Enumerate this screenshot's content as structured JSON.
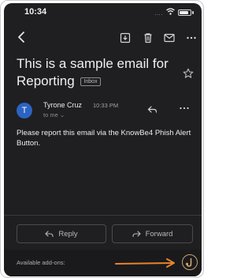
{
  "status_bar": {
    "time": "10:34",
    "signal_dots": "....",
    "wifi_icon": "wifi-icon",
    "battery_icon": "battery-icon"
  },
  "toolbar": {
    "back_icon": "chevron-left-icon",
    "archive_icon": "archive-icon",
    "delete_icon": "trash-icon",
    "mark_unread_icon": "mail-icon",
    "more_icon": "more-horizontal-icon"
  },
  "email": {
    "subject": "This is a sample email for Reporting",
    "label": "Inbox",
    "star_icon": "star-icon",
    "sender": {
      "initial": "T",
      "name": "Tyrone Cruz",
      "time": "10:33 PM",
      "recipient": "to me",
      "avatar_color": "#2b63c2"
    },
    "body": "Please report this email via the KnowBe4 Phish Alert Button."
  },
  "actions": {
    "reply_label": "Reply",
    "forward_label": "Forward"
  },
  "addons": {
    "label": "Available add-ons:",
    "addon_icon": "phish-hook-icon",
    "annotation_color": "#e8842a"
  },
  "colors": {
    "background": "#1f1f21",
    "text": "#ececee",
    "muted_text": "#8e8e92"
  }
}
